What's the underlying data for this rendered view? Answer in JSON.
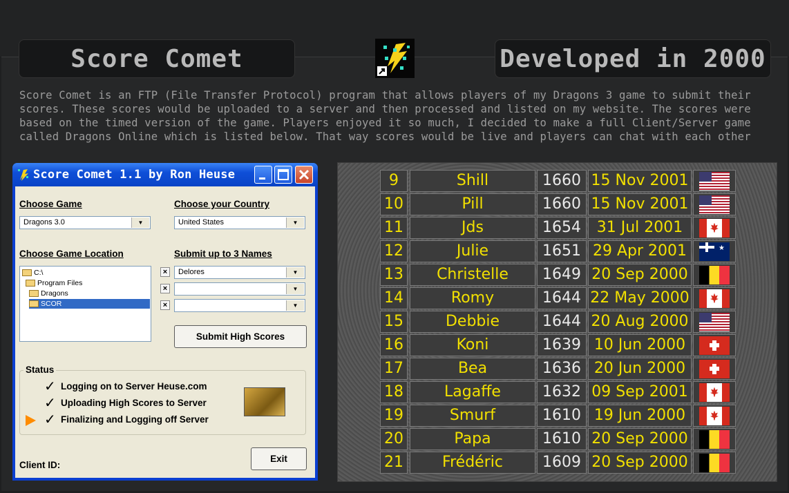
{
  "header": {
    "title_left": "Score Comet",
    "title_right": "Developed in 2000",
    "description_lines": [
      "Score Comet is an FTP (File Transfer Protocol) program that allows players of my Dragons 3 game to submit their",
      "scores. These scores would be uploaded to a server and then processed and listed on my website. The scores were",
      "based on the timed version of the game. Players enjoyed it so much, I decided to make a full Client/Server game",
      "called Dragons Online which is listed below. That way scores would be live and players can chat with each other"
    ]
  },
  "window": {
    "title": "Score Comet 1.1 by Ron Heuse",
    "choose_game_label": "Choose Game",
    "choose_game_value": "Dragons 3.0",
    "choose_country_label": "Choose your Country",
    "choose_country_value": "United States",
    "choose_location_label": "Choose Game Location",
    "folders": [
      "C:\\",
      "Program Files",
      "Dragons",
      "SCOR"
    ],
    "submit_names_label": "Submit up to 3 Names",
    "names": [
      "Delores",
      "",
      ""
    ],
    "clear_glyph": "×",
    "submit_button": "Submit High Scores",
    "status_label": "Status",
    "status_lines": [
      "Logging on to Server Heuse.com",
      "Uploading High Scores to Server",
      "Finalizing and Logging off Server"
    ],
    "check_glyph": "✓",
    "exit_button": "Exit",
    "client_id_label": "Client ID:"
  },
  "scores": [
    {
      "rank": "9",
      "name": "Shill",
      "score": "1660",
      "date": "15 Nov 2001",
      "flag": "usa"
    },
    {
      "rank": "10",
      "name": "Pill",
      "score": "1660",
      "date": "15 Nov 2001",
      "flag": "usa"
    },
    {
      "rank": "11",
      "name": "Jds",
      "score": "1654",
      "date": "31 Jul 2001",
      "flag": "can"
    },
    {
      "rank": "12",
      "name": "Julie",
      "score": "1651",
      "date": "29 Apr 2001",
      "flag": "aus"
    },
    {
      "rank": "13",
      "name": "Christelle",
      "score": "1649",
      "date": "20 Sep 2000",
      "flag": "bel"
    },
    {
      "rank": "14",
      "name": "Romy",
      "score": "1644",
      "date": "22 May 2000",
      "flag": "can"
    },
    {
      "rank": "15",
      "name": "Debbie",
      "score": "1644",
      "date": "20 Aug 2000",
      "flag": "usa"
    },
    {
      "rank": "16",
      "name": "Koni",
      "score": "1639",
      "date": "10 Jun 2000",
      "flag": "che"
    },
    {
      "rank": "17",
      "name": "Bea",
      "score": "1636",
      "date": "20 Jun 2000",
      "flag": "che"
    },
    {
      "rank": "18",
      "name": "Lagaffe",
      "score": "1632",
      "date": "09 Sep 2001",
      "flag": "can"
    },
    {
      "rank": "19",
      "name": "Smurf",
      "score": "1610",
      "date": "19 Jun 2000",
      "flag": "can"
    },
    {
      "rank": "20",
      "name": "Papa",
      "score": "1610",
      "date": "20 Sep 2000",
      "flag": "bel"
    },
    {
      "rank": "21",
      "name": "Frédéric",
      "score": "1609",
      "date": "20 Sep 2000",
      "flag": "bel"
    }
  ]
}
